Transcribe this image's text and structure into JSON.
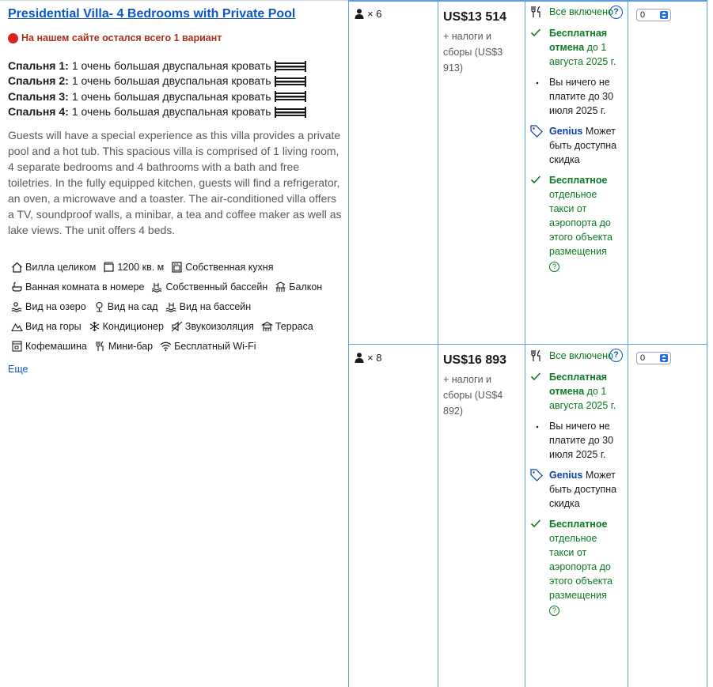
{
  "room": {
    "title": "Presidential Villa- 4 Bedrooms with Private Pool",
    "scarcity": "На нашем сайте остался всего 1 вариант",
    "beds": [
      {
        "label": "Спальня 1:",
        "value": "1 очень большая двуспальная кровать"
      },
      {
        "label": "Спальня 2:",
        "value": "1 очень большая двуспальная кровать"
      },
      {
        "label": "Спальня 3:",
        "value": "1 очень большая двуспальная кровать"
      },
      {
        "label": "Спальня 4:",
        "value": "1 очень большая двуспальная кровать"
      }
    ],
    "description": "Guests will have a special experience as this villa provides a private pool and a hot tub. This spacious villa is comprised of 1 living room, 4 separate bedrooms and 4 bathrooms with a bath and free toiletries. In the fully equipped kitchen, guests will find a refrigerator, an oven, a microwave and a toaster. The air-conditioned villa offers a TV, soundproof walls, a minibar, a tea and coffee maker as well as lake views. The unit offers 4 beds.",
    "facilities": [
      [
        {
          "icon": "house-icon",
          "label": "Вилла целиком"
        },
        {
          "icon": "area-icon",
          "label": "1200 кв. м"
        },
        {
          "icon": "kitchen-icon",
          "label": "Собственная кухня"
        }
      ],
      [
        {
          "icon": "bath-icon",
          "label": "Ванная комната в номере"
        },
        {
          "icon": "pool-icon",
          "label": "Собственный бассейн"
        },
        {
          "icon": "balcony-icon",
          "label": "Балкон"
        }
      ],
      [
        {
          "icon": "lake-icon",
          "label": "Вид на озеро"
        },
        {
          "icon": "garden-icon",
          "label": "Вид на сад"
        },
        {
          "icon": "pool-view-icon",
          "label": "Вид на бассейн"
        }
      ],
      [
        {
          "icon": "mountain-icon",
          "label": "Вид на горы"
        },
        {
          "icon": "snowflake-icon",
          "label": "Кондиционер"
        },
        {
          "icon": "soundproof-icon",
          "label": "Звукоизоляция"
        },
        {
          "icon": "terrace-icon",
          "label": "Терраса"
        }
      ],
      [
        {
          "icon": "coffee-machine-icon",
          "label": "Кофемашина"
        },
        {
          "icon": "minibar-icon",
          "label": "Мини-бар"
        },
        {
          "icon": "wifi-icon",
          "label": "Бесплатный Wi-Fi"
        }
      ]
    ],
    "more_link": "Еще"
  },
  "options": [
    {
      "guests": "× 6",
      "price": "US$13 514",
      "taxes": "+ налоги и сборы (US$3 913)",
      "meal": "Все включено",
      "cancel_bold": "Бесплатная отмена",
      "cancel_rest": " до 1 августа 2025 г.",
      "pay_later": "Вы ничего не платите до 30 июля 2025 г.",
      "genius_brand": "Genius",
      "genius_text": " Может быть доступна скидка",
      "taxi_bold": "Бесплатное",
      "taxi_rest": " отдельное такси от аэропорта до этого объекта размещения",
      "help_mark": "?",
      "select_value": "0"
    },
    {
      "guests": "× 8",
      "price": "US$16 893",
      "taxes": "+ налоги и сборы (US$4 892)",
      "meal": "Все включено",
      "cancel_bold": "Бесплатная отмена",
      "cancel_rest": " до 1 августа 2025 г.",
      "pay_later": "Вы ничего не платите до 30 июля 2025 г.",
      "genius_brand": "Genius",
      "genius_text": " Может быть доступна скидка",
      "taxi_bold": "Бесплатное",
      "taxi_rest": " отдельное такси от аэропорта до этого объекта размещения",
      "help_mark": "?",
      "select_value": "0"
    }
  ],
  "info_mark": "?",
  "colors": {
    "link_blue": "#0b57c8",
    "grid_blue": "#5a9de0",
    "scarcity_red": "#a6311a",
    "success_green": "#0b7a22",
    "genius_blue": "#0b3ea8"
  }
}
